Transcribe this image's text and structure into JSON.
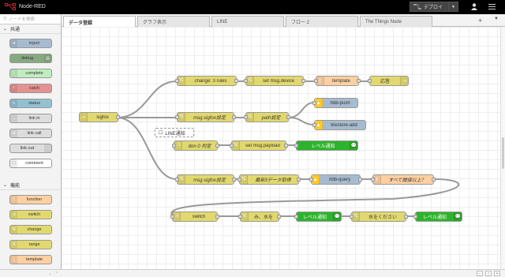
{
  "app": {
    "title": "Node-RED"
  },
  "header": {
    "deploy_label": "デプロイ"
  },
  "palette": {
    "search_placeholder": "ノードを検索",
    "categories": [
      {
        "label": "共通",
        "nodes": [
          "inject",
          "debug",
          "complete",
          "catch",
          "status",
          "link in",
          "link call",
          "link out",
          "comment"
        ]
      },
      {
        "label": "機能",
        "nodes": [
          "function",
          "switch",
          "change",
          "range",
          "template"
        ]
      }
    ]
  },
  "tabs": [
    "データ登録",
    "グラフ表示",
    "LINE",
    "フロー 2",
    "The Things Node"
  ],
  "colors": {
    "change": "#e2d96e",
    "function": "#fdd0a2",
    "db": "#a6bbcf",
    "line": "#2cb42c",
    "debug": "#87a980",
    "catch": "#e49191",
    "status": "#94c1d0",
    "link": "#dddddd",
    "inject": "#a6bbcf"
  },
  "flow": {
    "nodes": {
      "sigfox": "sigfox",
      "change3": "change: 3 rules",
      "setdevice": "set msg.device",
      "template": "template",
      "response": "応答",
      "msgset1": "msg.sigfox設定",
      "pathset": "path設定",
      "rtdbpush": "rtdb-push",
      "firestore": "firestore-add",
      "comment_line": "LINE通知",
      "dnn": "dnn 0 判定",
      "setpayload": "set msg.payload",
      "level1": "レベル通知",
      "msgset2": "msg.sigfox設定",
      "latest3": "最新3データ取得",
      "rtdbquery": "rtdb-query",
      "allover": "すべて閾値以上？",
      "switch": "switch",
      "mizuwo": "み、水を",
      "level2": "レベル通知",
      "mizukudasai": "水をください",
      "level3": "レベル通知"
    }
  }
}
